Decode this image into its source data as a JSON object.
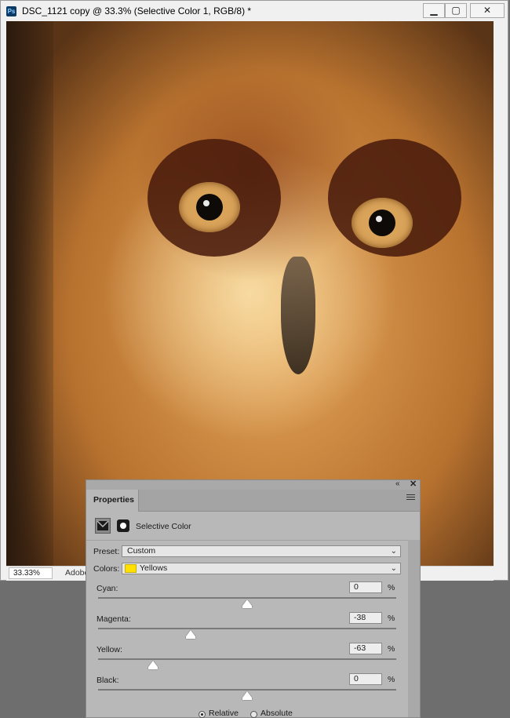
{
  "window": {
    "app_icon": "Ps",
    "title": "DSC_1121 copy @ 33.3% (Selective Color 1, RGB/8) *",
    "controls": {
      "minimize": "▁",
      "maximize": "▢",
      "close": "✕"
    }
  },
  "statusbar": {
    "zoom": "33.33%",
    "info": "Adobe"
  },
  "properties": {
    "tab": "Properties",
    "collapse_glyph": "«",
    "close_glyph": "✕",
    "adjustment_label": "Selective Color",
    "preset": {
      "label": "Preset:",
      "value": "Custom"
    },
    "colors": {
      "label": "Colors:",
      "value": "Yellows",
      "swatch_color": "#ffe000"
    },
    "sliders": [
      {
        "label": "Cyan:",
        "value": "0",
        "percent": 0,
        "unit": "%"
      },
      {
        "label": "Magenta:",
        "value": "-38",
        "percent": -38,
        "unit": "%"
      },
      {
        "label": "Yellow:",
        "value": "-63",
        "percent": -63,
        "unit": "%"
      },
      {
        "label": "Black:",
        "value": "0",
        "percent": 0,
        "unit": "%"
      }
    ],
    "method": {
      "options": [
        "Relative",
        "Absolute"
      ],
      "selected": "Relative"
    }
  }
}
